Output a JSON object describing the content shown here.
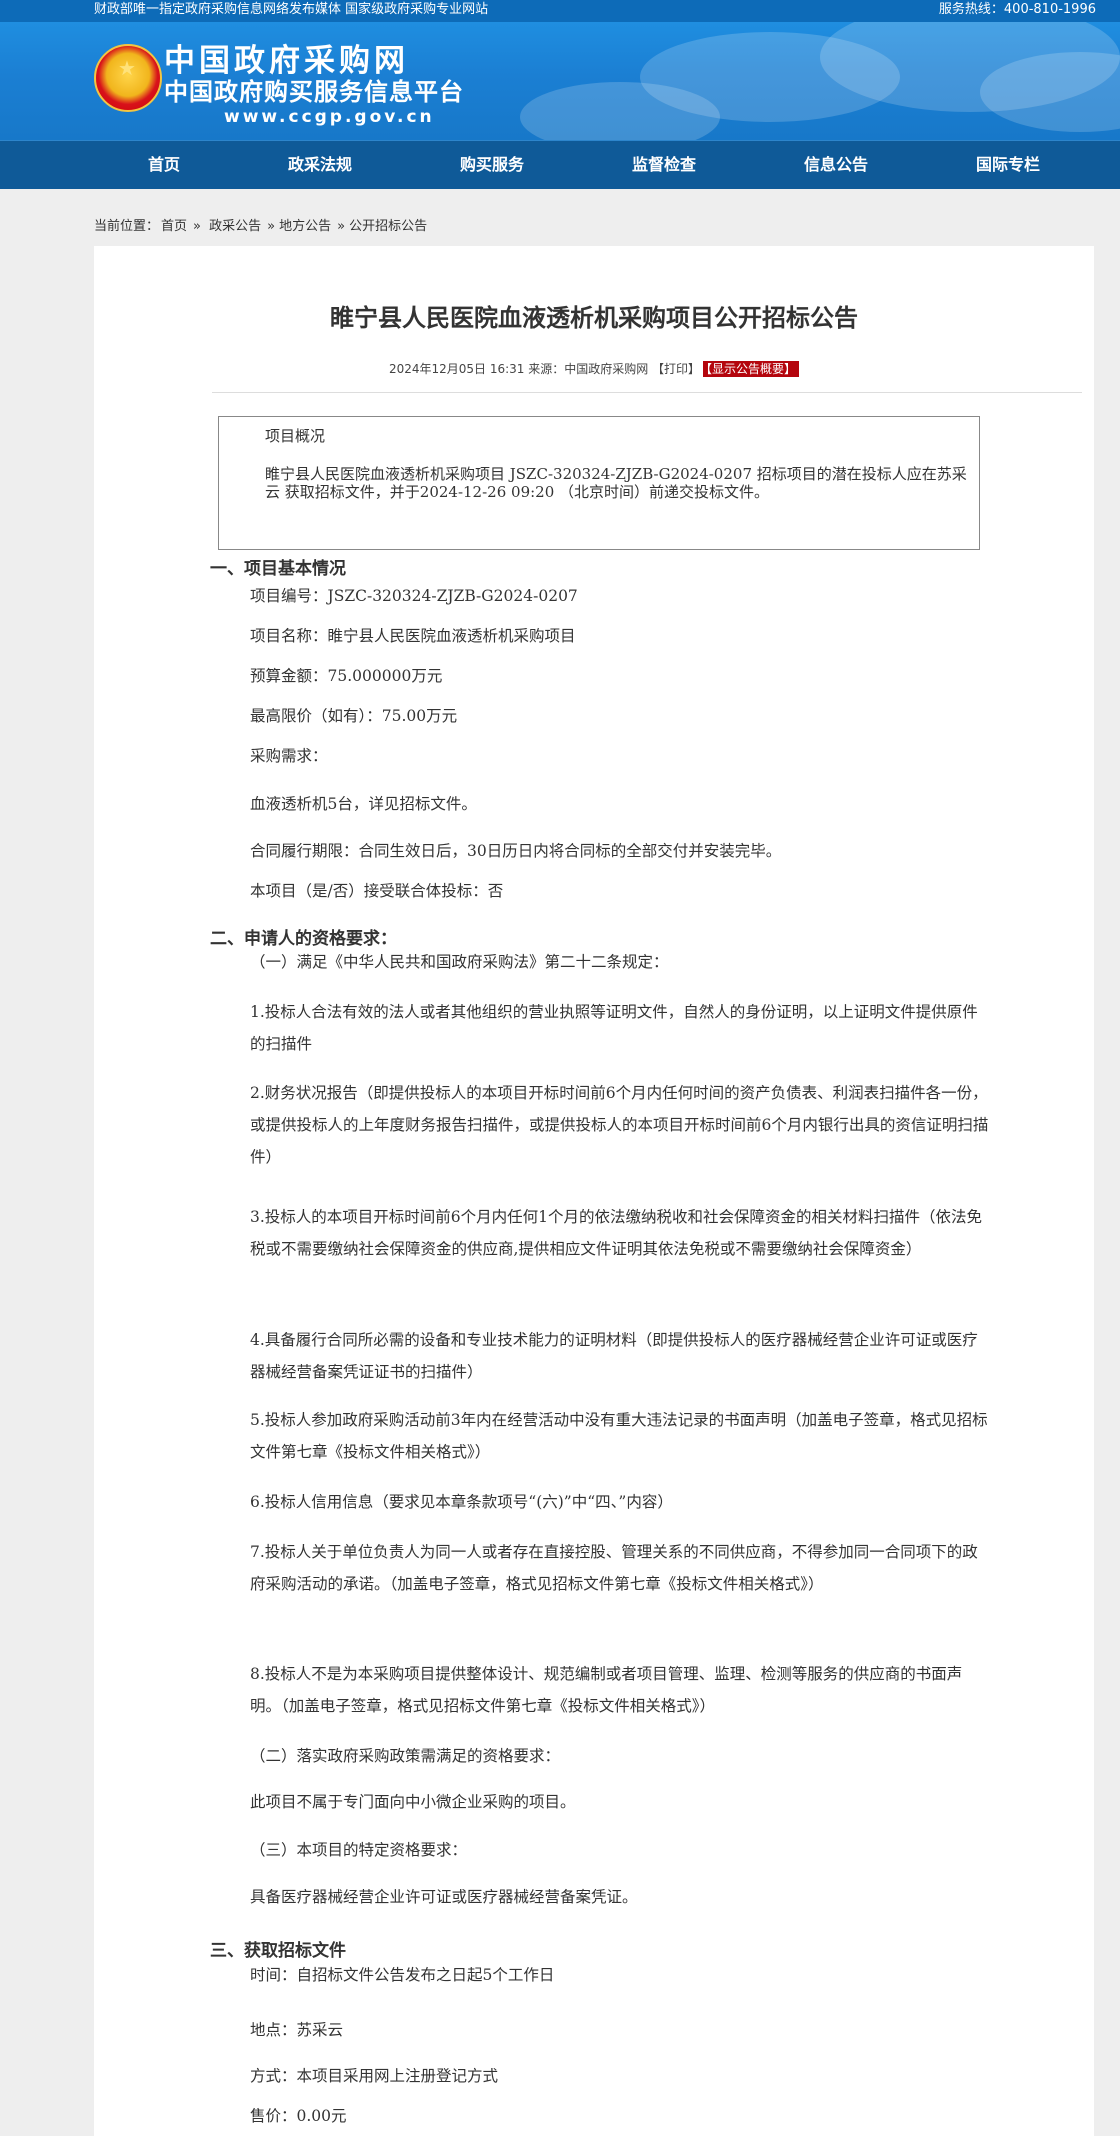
{
  "topbar": {
    "left": "财政部唯一指定政府采购信息网络发布媒体 国家级政府采购专业网站",
    "right": "服务热线：400-810-1996"
  },
  "logo": {
    "title": "中国政府采购网",
    "subtitle": "中国政府购买服务信息平台",
    "url": "www.ccgp.gov.cn"
  },
  "nav": [
    "首页",
    "政采法规",
    "购买服务",
    "监督检查",
    "信息公告",
    "国际专栏"
  ],
  "breadcrumb": {
    "label": "当前位置：",
    "items": [
      "首页",
      "政采公告",
      "地方公告",
      "公开招标公告"
    ]
  },
  "article": {
    "title": "睢宁县人民医院血液透析机采购项目公开招标公告",
    "meta": "2024年12月05日 16:31 来源：中国政府采购网 【打印】",
    "brief_button": "【显示公告概要】",
    "summary_title": "项目概况",
    "summary_body": "睢宁县人民医院血液透析机采购项目 JSZC-320324-ZJZB-G2024-0207 招标项目的潜在投标人应在苏采云 获取招标文件，并于2024-12-26 09:20 （北京时间）前递交投标文件。"
  },
  "sections": [
    {
      "heading": "一、项目基本情况",
      "paras": [
        "项目编号：JSZC-320324-ZJZB-G2024-0207",
        "项目名称：睢宁县人民医院血液透析机采购项目",
        "预算金额：75.000000万元",
        "最高限价（如有）：75.00万元",
        "采购需求：",
        "血液透析机5台，详见招标文件。",
        "合同履行期限：合同生效日后，30日历日内将合同标的全部交付并安装完毕。",
        "本项目（是/否）接受联合体投标：否"
      ]
    },
    {
      "heading": "二、申请人的资格要求：",
      "paras": [
        "（一）满足《中华人民共和国政府采购法》第二十二条规定：",
        "1.投标人合法有效的法人或者其他组织的营业执照等证明文件，自然人的身份证明，以上证明文件提供原件的扫描件",
        "2.财务状况报告（即提供投标人的本项目开标时间前6个月内任何时间的资产负债表、利润表扫描件各一份，或提供投标人的上年度财务报告扫描件，或提供投标人的本项目开标时间前6个月内银行出具的资信证明扫描件）",
        "3.投标人的本项目开标时间前6个月内任何1个月的依法缴纳税收和社会保障资金的相关材料扫描件（依法免税或不需要缴纳社会保障资金的供应商,提供相应文件证明其依法免税或不需要缴纳社会保障资金）",
        "4.具备履行合同所必需的设备和专业技术能力的证明材料（即提供投标人的医疗器械经营企业许可证或医疗器械经营备案凭证证书的扫描件）",
        "5.投标人参加政府采购活动前3年内在经营活动中没有重大违法记录的书面声明（加盖电子签章，格式见招标文件第七章《投标文件相关格式》）",
        "6.投标人信用信息（要求见本章条款项号“(六)”中“四、”内容）",
        "7.投标人关于单位负责人为同一人或者存在直接控股、管理关系的不同供应商，不得参加同一合同项下的政府采购活动的承诺。（加盖电子签章，格式见招标文件第七章《投标文件相关格式》）",
        "8.投标人不是为本采购项目提供整体设计、规范编制或者项目管理、监理、检测等服务的供应商的书面声明。（加盖电子签章，格式见招标文件第七章《投标文件相关格式》）",
        "（二）落实政府采购政策需满足的资格要求：",
        "此项目不属于专门面向中小微企业采购的项目。",
        "（三）本项目的特定资格要求：",
        "具备医疗器械经营企业许可证或医疗器械经营备案凭证。"
      ]
    },
    {
      "heading": "三、获取招标文件",
      "paras": [
        "时间：自招标文件公告发布之日起5个工作日",
        "地点：苏采云",
        "方式：本项目采用网上注册登记方式",
        "售价：0.00元"
      ]
    }
  ]
}
